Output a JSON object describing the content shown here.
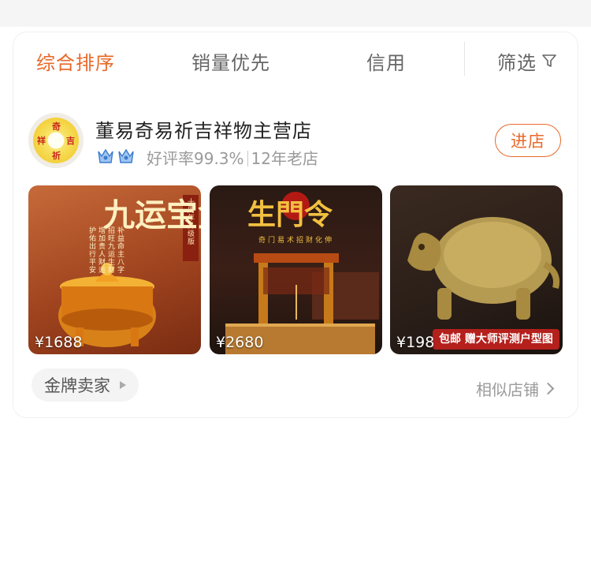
{
  "sort_bar": {
    "tabs": [
      {
        "label": "综合排序",
        "active": true
      },
      {
        "label": "销量优先",
        "active": false
      },
      {
        "label": "信用",
        "active": false
      }
    ],
    "filter_label": "筛选",
    "filter_icon": "filter-icon"
  },
  "store": {
    "logo_chars": [
      "奇",
      "吉",
      "祈",
      "祥"
    ],
    "name": "董易奇易祈吉祥物主营店",
    "rating": "好评率99.3%",
    "age": "12年老店",
    "badge_icon": "crown-icon",
    "enter_label": "进店"
  },
  "products": [
    {
      "price": "¥1688",
      "art_title": "九运宝盒",
      "art_side": "十周年升级版",
      "art_lines": [
        "补益命主八字",
        "招旺九运生财",
        "增加贵人财运",
        "护佑出行平安"
      ]
    },
    {
      "price": "¥2680",
      "art_title": "生門令",
      "art_sub": "奇门易术招财化伸"
    },
    {
      "price": "¥198",
      "promo": "包邮 赠大师评测户型图"
    }
  ],
  "footer": {
    "gold_seller": "金牌卖家",
    "similar_stores": "相似店铺"
  },
  "colors": {
    "accent": "#e8692a",
    "text_dark": "#222222",
    "text_gray": "#9a9a9a",
    "promo_red": "#b4201c"
  }
}
